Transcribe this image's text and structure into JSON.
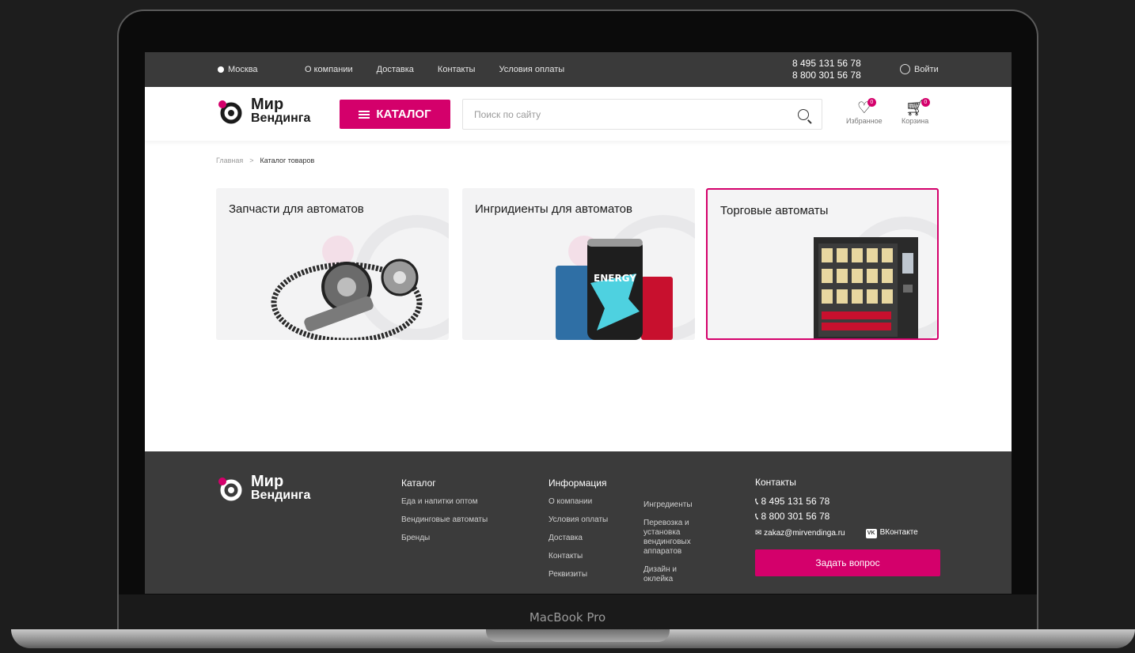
{
  "device": {
    "label": "MacBook Pro"
  },
  "topbar": {
    "city": "Москва",
    "nav": [
      "О компании",
      "Доставка",
      "Контакты",
      "Условия оплаты"
    ],
    "phones": [
      "8 495 131 56 78",
      "8 800 301 56 78"
    ],
    "login": "Войти"
  },
  "header": {
    "logo_line1": "Мир",
    "logo_line2": "Вендинга",
    "catalog_label": "КАТАЛОГ",
    "search_placeholder": "Поиск по сайту",
    "favorites_label": "Избранное",
    "favorites_count": "0",
    "cart_label": "Корзина",
    "cart_count": "0"
  },
  "breadcrumb": {
    "home": "Главная",
    "separator": ">",
    "current": "Каталог товаров"
  },
  "categories": [
    {
      "title": "Запчасти для автоматов"
    },
    {
      "title": "Ингридиенты для автоматов"
    },
    {
      "title": "Торговые автоматы"
    }
  ],
  "footer": {
    "logo_line1": "Мир",
    "logo_line2": "Вендинга",
    "catalog": {
      "heading": "Каталог",
      "links": [
        "Еда и напитки оптом",
        "Вендинговые автоматы",
        "Бренды"
      ]
    },
    "info": {
      "heading": "Информация",
      "links": [
        "О компании",
        "Условия оплаты",
        "Доставка",
        "Контакты",
        "Реквизиты"
      ],
      "links2": [
        "Ингредиенты",
        "Перевозка и установка вендинговых аппаратов",
        "Дизайн и оклейка"
      ]
    },
    "contacts": {
      "heading": "Контакты",
      "phone1": "8 495 131 56 78",
      "phone2": "8 800 301 56 78",
      "email": "zakaz@mirvendinga.ru",
      "vk": "ВКонтакте",
      "ask_button": "Задать вопрос"
    }
  },
  "colors": {
    "accent": "#d4006b",
    "dark": "#3a3a3a"
  }
}
